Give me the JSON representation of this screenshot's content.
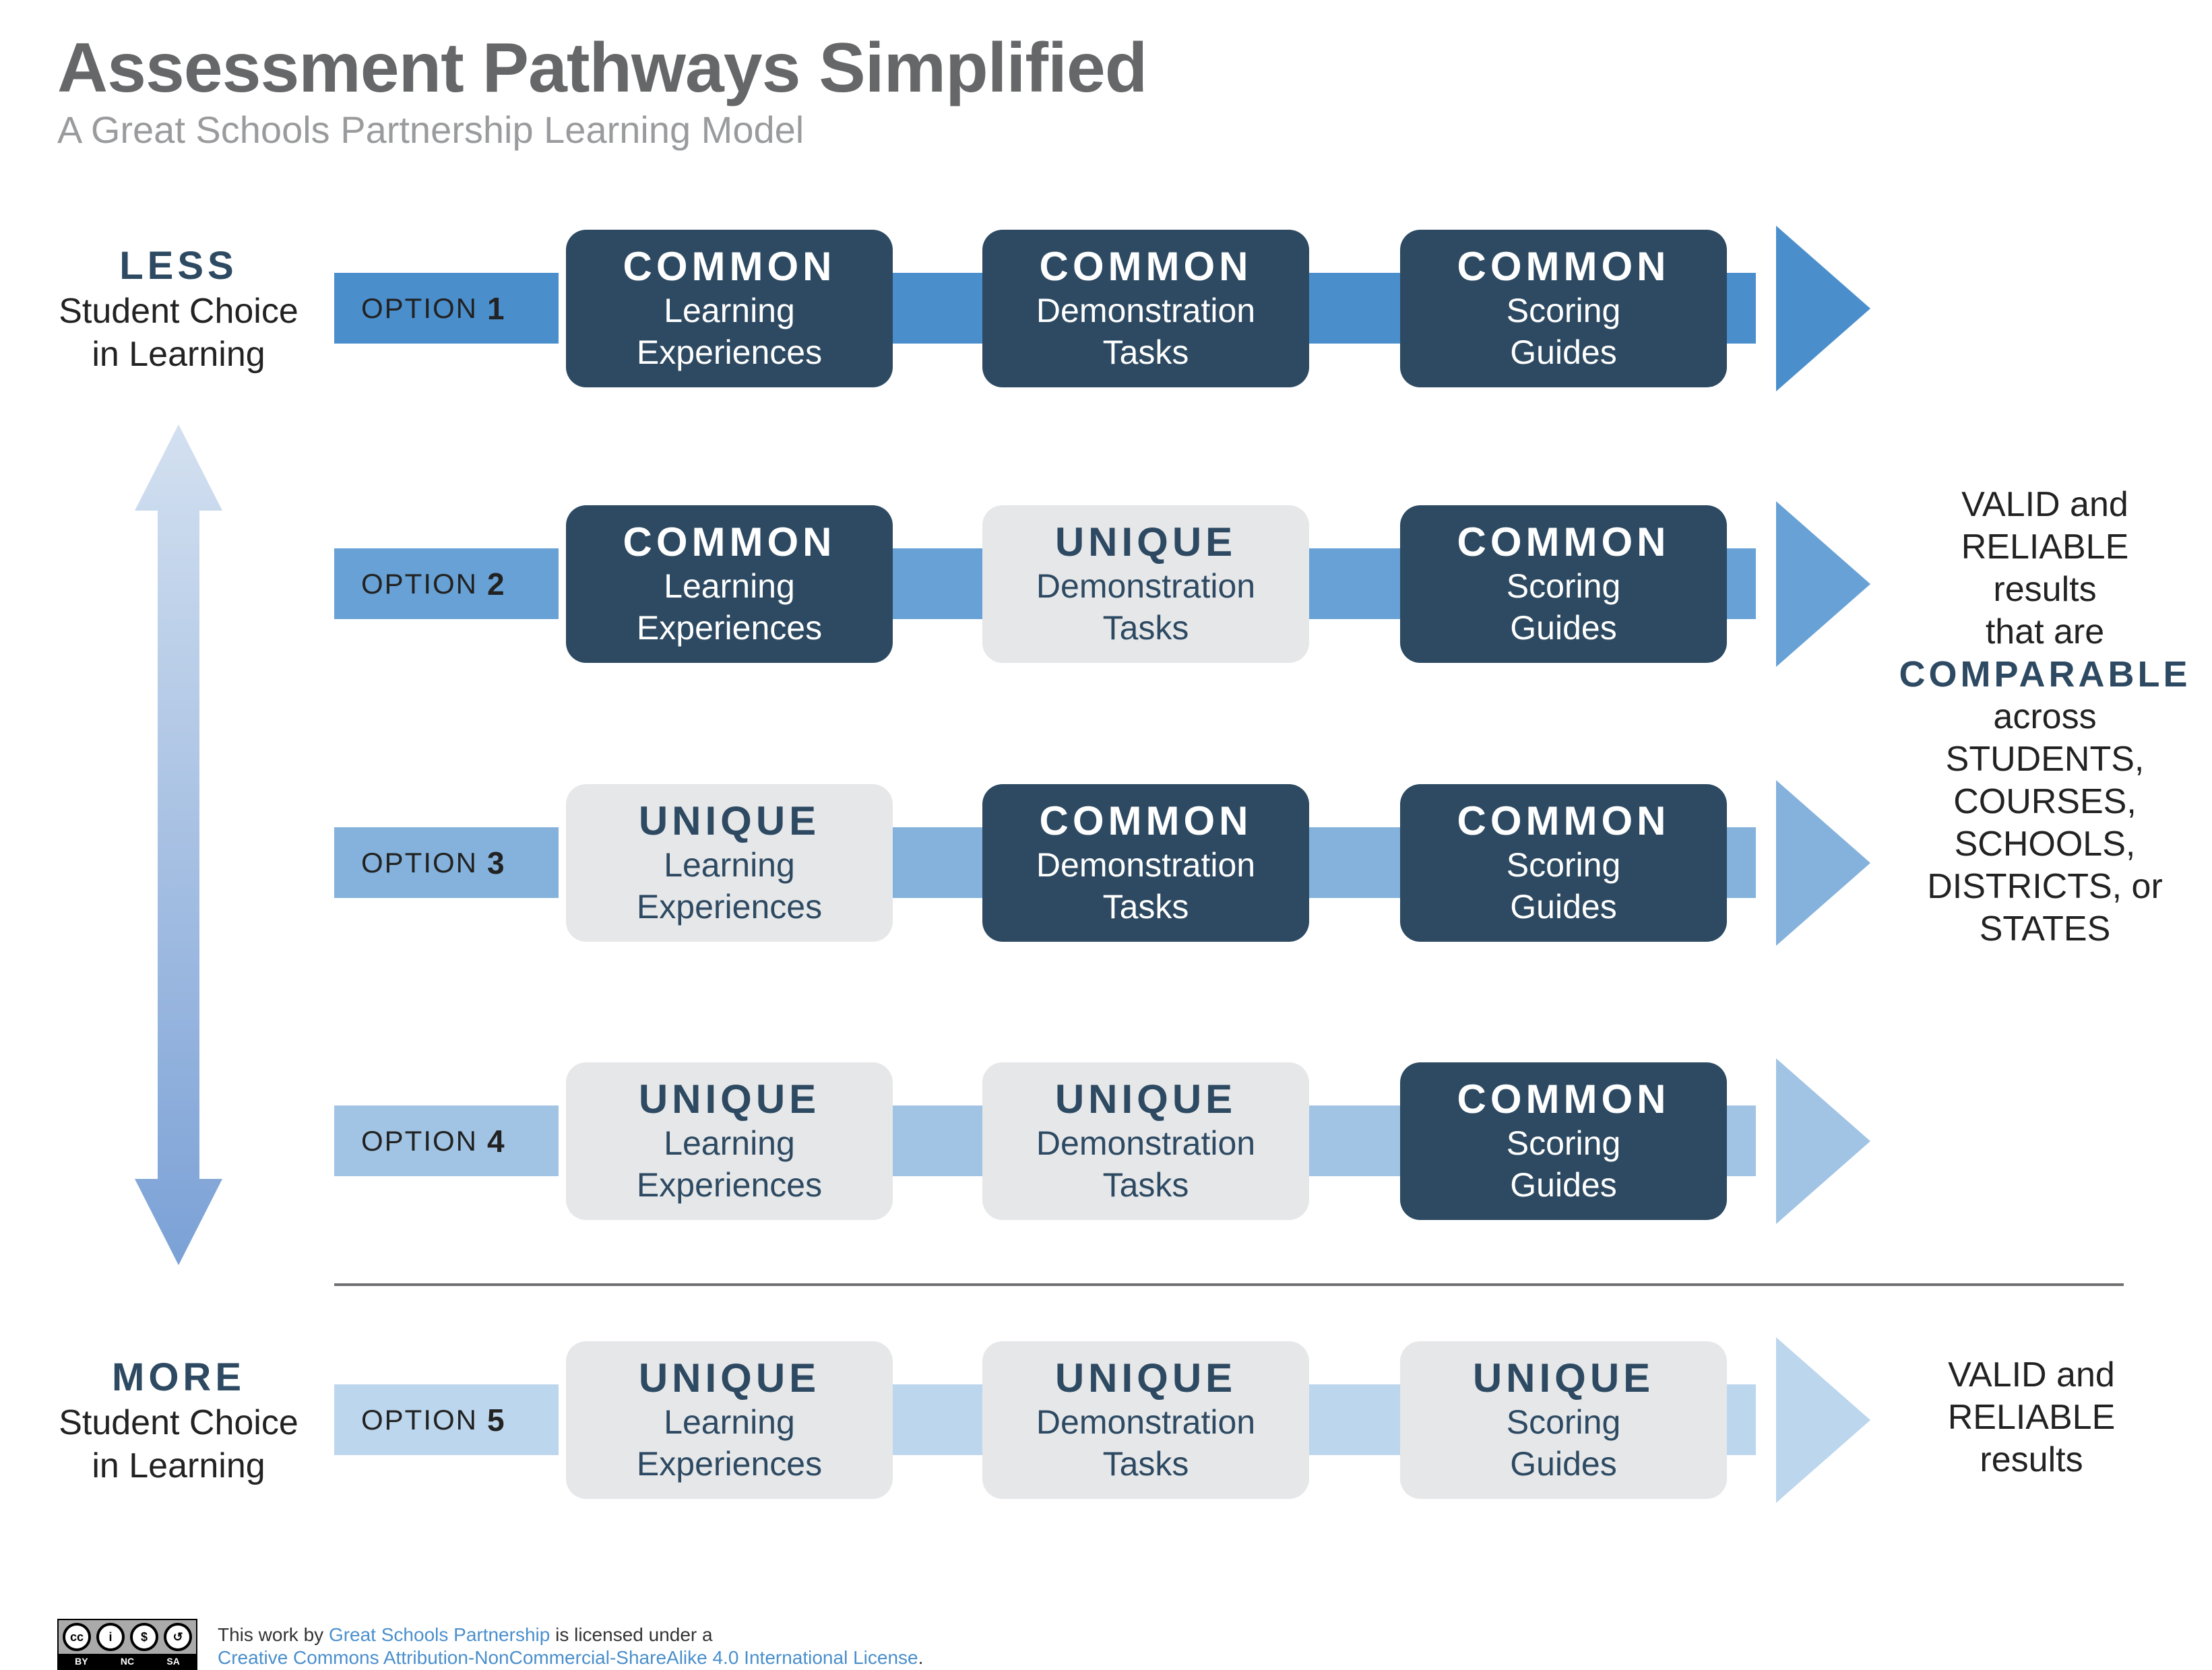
{
  "header": {
    "title": "Assessment Pathways Simplified",
    "subtitle": "A Great Schools Partnership Learning Model"
  },
  "scale": {
    "top": {
      "emphasis": "LESS",
      "line1": "Student Choice",
      "line2": "in Learning"
    },
    "bottom": {
      "emphasis": "MORE",
      "line1": "Student Choice",
      "line2": "in Learning"
    },
    "arrow_icon": "double-headed-vertical-arrow"
  },
  "colors": {
    "dark_box": "#2d4a62",
    "light_box": "#e6e7e9",
    "row_bands": [
      "#4a8fcc",
      "#67a1d5",
      "#84b2dc",
      "#a1c4e4",
      "#bcd6ed"
    ]
  },
  "option_label": "OPTION",
  "rows": [
    {
      "number": "1",
      "boxes": [
        {
          "kind": "COMMON",
          "l1": "Learning",
          "l2": "Experiences"
        },
        {
          "kind": "COMMON",
          "l1": "Demonstration",
          "l2": "Tasks"
        },
        {
          "kind": "COMMON",
          "l1": "Scoring",
          "l2": "Guides"
        }
      ]
    },
    {
      "number": "2",
      "boxes": [
        {
          "kind": "COMMON",
          "l1": "Learning",
          "l2": "Experiences"
        },
        {
          "kind": "UNIQUE",
          "l1": "Demonstration",
          "l2": "Tasks"
        },
        {
          "kind": "COMMON",
          "l1": "Scoring",
          "l2": "Guides"
        }
      ]
    },
    {
      "number": "3",
      "boxes": [
        {
          "kind": "UNIQUE",
          "l1": "Learning",
          "l2": "Experiences"
        },
        {
          "kind": "COMMON",
          "l1": "Demonstration",
          "l2": "Tasks"
        },
        {
          "kind": "COMMON",
          "l1": "Scoring",
          "l2": "Guides"
        }
      ]
    },
    {
      "number": "4",
      "boxes": [
        {
          "kind": "UNIQUE",
          "l1": "Learning",
          "l2": "Experiences"
        },
        {
          "kind": "UNIQUE",
          "l1": "Demonstration",
          "l2": "Tasks"
        },
        {
          "kind": "COMMON",
          "l1": "Scoring",
          "l2": "Guides"
        }
      ]
    },
    {
      "number": "5",
      "boxes": [
        {
          "kind": "UNIQUE",
          "l1": "Learning",
          "l2": "Experiences"
        },
        {
          "kind": "UNIQUE",
          "l1": "Demonstration",
          "l2": "Tasks"
        },
        {
          "kind": "UNIQUE",
          "l1": "Scoring",
          "l2": "Guides"
        }
      ]
    }
  ],
  "results": {
    "comparable": {
      "lines_before": [
        "VALID and",
        "RELIABLE",
        "results",
        "that are"
      ],
      "emphasis": "COMPARABLE",
      "lines_after": [
        "across",
        "STUDENTS,",
        "COURSES,",
        "SCHOOLS,",
        "DISTRICTS, or",
        "STATES"
      ]
    },
    "basic": {
      "lines": [
        "VALID and",
        "RELIABLE",
        "results"
      ]
    }
  },
  "footer": {
    "badge_labels": [
      "BY",
      "NC",
      "SA"
    ],
    "text_prefix": "This work by ",
    "author_link": "Great Schools Partnership",
    "text_mid": " is licensed under a",
    "license_link": "Creative Commons Attribution-NonCommercial-ShareAlike 4.0 International License",
    "text_suffix": "."
  }
}
